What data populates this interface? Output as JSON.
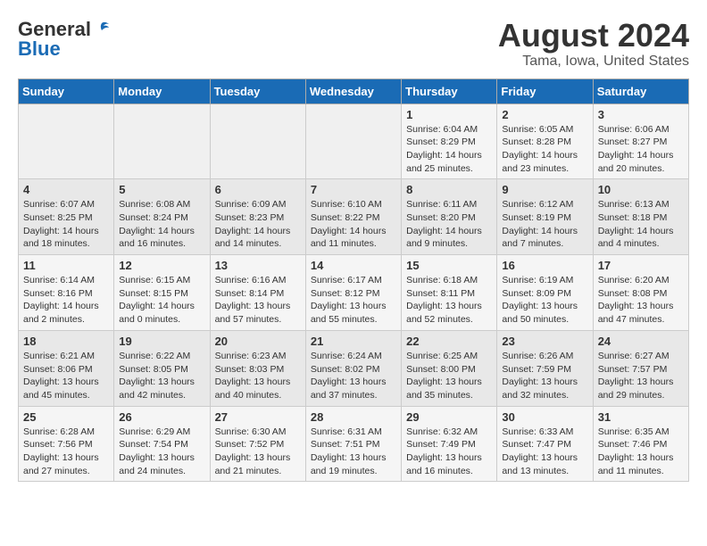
{
  "logo": {
    "line1": "General",
    "line2": "Blue"
  },
  "title": "August 2024",
  "subtitle": "Tama, Iowa, United States",
  "days_of_week": [
    "Sunday",
    "Monday",
    "Tuesday",
    "Wednesday",
    "Thursday",
    "Friday",
    "Saturday"
  ],
  "weeks": [
    [
      {
        "day": "",
        "info": ""
      },
      {
        "day": "",
        "info": ""
      },
      {
        "day": "",
        "info": ""
      },
      {
        "day": "",
        "info": ""
      },
      {
        "day": "1",
        "info": "Sunrise: 6:04 AM\nSunset: 8:29 PM\nDaylight: 14 hours\nand 25 minutes."
      },
      {
        "day": "2",
        "info": "Sunrise: 6:05 AM\nSunset: 8:28 PM\nDaylight: 14 hours\nand 23 minutes."
      },
      {
        "day": "3",
        "info": "Sunrise: 6:06 AM\nSunset: 8:27 PM\nDaylight: 14 hours\nand 20 minutes."
      }
    ],
    [
      {
        "day": "4",
        "info": "Sunrise: 6:07 AM\nSunset: 8:25 PM\nDaylight: 14 hours\nand 18 minutes."
      },
      {
        "day": "5",
        "info": "Sunrise: 6:08 AM\nSunset: 8:24 PM\nDaylight: 14 hours\nand 16 minutes."
      },
      {
        "day": "6",
        "info": "Sunrise: 6:09 AM\nSunset: 8:23 PM\nDaylight: 14 hours\nand 14 minutes."
      },
      {
        "day": "7",
        "info": "Sunrise: 6:10 AM\nSunset: 8:22 PM\nDaylight: 14 hours\nand 11 minutes."
      },
      {
        "day": "8",
        "info": "Sunrise: 6:11 AM\nSunset: 8:20 PM\nDaylight: 14 hours\nand 9 minutes."
      },
      {
        "day": "9",
        "info": "Sunrise: 6:12 AM\nSunset: 8:19 PM\nDaylight: 14 hours\nand 7 minutes."
      },
      {
        "day": "10",
        "info": "Sunrise: 6:13 AM\nSunset: 8:18 PM\nDaylight: 14 hours\nand 4 minutes."
      }
    ],
    [
      {
        "day": "11",
        "info": "Sunrise: 6:14 AM\nSunset: 8:16 PM\nDaylight: 14 hours\nand 2 minutes."
      },
      {
        "day": "12",
        "info": "Sunrise: 6:15 AM\nSunset: 8:15 PM\nDaylight: 14 hours\nand 0 minutes."
      },
      {
        "day": "13",
        "info": "Sunrise: 6:16 AM\nSunset: 8:14 PM\nDaylight: 13 hours\nand 57 minutes."
      },
      {
        "day": "14",
        "info": "Sunrise: 6:17 AM\nSunset: 8:12 PM\nDaylight: 13 hours\nand 55 minutes."
      },
      {
        "day": "15",
        "info": "Sunrise: 6:18 AM\nSunset: 8:11 PM\nDaylight: 13 hours\nand 52 minutes."
      },
      {
        "day": "16",
        "info": "Sunrise: 6:19 AM\nSunset: 8:09 PM\nDaylight: 13 hours\nand 50 minutes."
      },
      {
        "day": "17",
        "info": "Sunrise: 6:20 AM\nSunset: 8:08 PM\nDaylight: 13 hours\nand 47 minutes."
      }
    ],
    [
      {
        "day": "18",
        "info": "Sunrise: 6:21 AM\nSunset: 8:06 PM\nDaylight: 13 hours\nand 45 minutes."
      },
      {
        "day": "19",
        "info": "Sunrise: 6:22 AM\nSunset: 8:05 PM\nDaylight: 13 hours\nand 42 minutes."
      },
      {
        "day": "20",
        "info": "Sunrise: 6:23 AM\nSunset: 8:03 PM\nDaylight: 13 hours\nand 40 minutes."
      },
      {
        "day": "21",
        "info": "Sunrise: 6:24 AM\nSunset: 8:02 PM\nDaylight: 13 hours\nand 37 minutes."
      },
      {
        "day": "22",
        "info": "Sunrise: 6:25 AM\nSunset: 8:00 PM\nDaylight: 13 hours\nand 35 minutes."
      },
      {
        "day": "23",
        "info": "Sunrise: 6:26 AM\nSunset: 7:59 PM\nDaylight: 13 hours\nand 32 minutes."
      },
      {
        "day": "24",
        "info": "Sunrise: 6:27 AM\nSunset: 7:57 PM\nDaylight: 13 hours\nand 29 minutes."
      }
    ],
    [
      {
        "day": "25",
        "info": "Sunrise: 6:28 AM\nSunset: 7:56 PM\nDaylight: 13 hours\nand 27 minutes."
      },
      {
        "day": "26",
        "info": "Sunrise: 6:29 AM\nSunset: 7:54 PM\nDaylight: 13 hours\nand 24 minutes."
      },
      {
        "day": "27",
        "info": "Sunrise: 6:30 AM\nSunset: 7:52 PM\nDaylight: 13 hours\nand 21 minutes."
      },
      {
        "day": "28",
        "info": "Sunrise: 6:31 AM\nSunset: 7:51 PM\nDaylight: 13 hours\nand 19 minutes."
      },
      {
        "day": "29",
        "info": "Sunrise: 6:32 AM\nSunset: 7:49 PM\nDaylight: 13 hours\nand 16 minutes."
      },
      {
        "day": "30",
        "info": "Sunrise: 6:33 AM\nSunset: 7:47 PM\nDaylight: 13 hours\nand 13 minutes."
      },
      {
        "day": "31",
        "info": "Sunrise: 6:35 AM\nSunset: 7:46 PM\nDaylight: 13 hours\nand 11 minutes."
      }
    ]
  ]
}
